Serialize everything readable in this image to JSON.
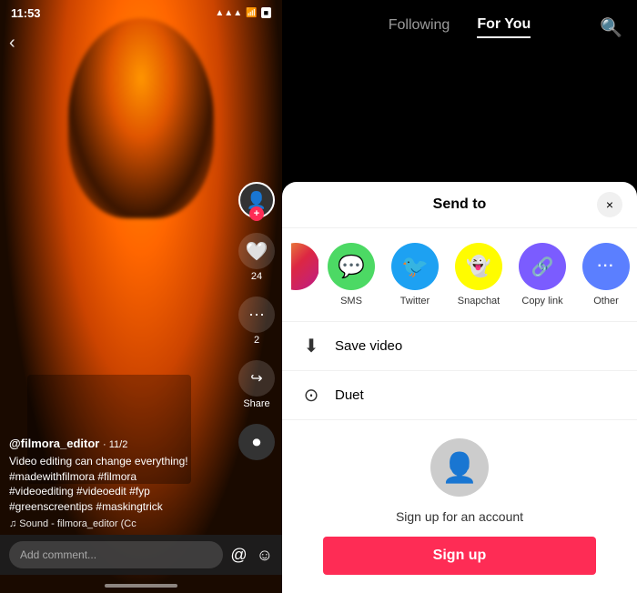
{
  "left": {
    "status_time": "11:53",
    "back_label": "‹",
    "user_name": "@filmora_editor",
    "user_date": "11/2",
    "video_desc": "Video editing can change everything!\n#madewithfilmora #filmora\n#videoediting #videoedit #fyp\n#greenscreentips #maskingtrick",
    "video_music": "♫ Sound - filmora_editor (Cc",
    "comment_placeholder": "Add comment...",
    "like_count": "24",
    "comment_count": "2",
    "share_label": "Share"
  },
  "right": {
    "nav_following": "Following",
    "nav_for_you": "For You",
    "sheet_title": "Send to",
    "close_label": "×",
    "share_apps": [
      {
        "id": "partial",
        "label": ""
      },
      {
        "id": "sms",
        "label": "SMS",
        "icon": "💬",
        "color": "#4cd964"
      },
      {
        "id": "twitter",
        "label": "Twitter",
        "icon": "🐦",
        "color": "#1da1f2"
      },
      {
        "id": "snapchat",
        "label": "Snapchat",
        "icon": "👻",
        "color": "#fffc00"
      },
      {
        "id": "copylink",
        "label": "Copy link",
        "icon": "🔗",
        "color": "#7b5cff"
      },
      {
        "id": "other",
        "label": "Other",
        "icon": "···",
        "color": "#5b7fff"
      }
    ],
    "action_save": "Save video",
    "action_duet": "Duet",
    "signup_text": "Sign up for an account",
    "signup_btn": "Sign up"
  }
}
